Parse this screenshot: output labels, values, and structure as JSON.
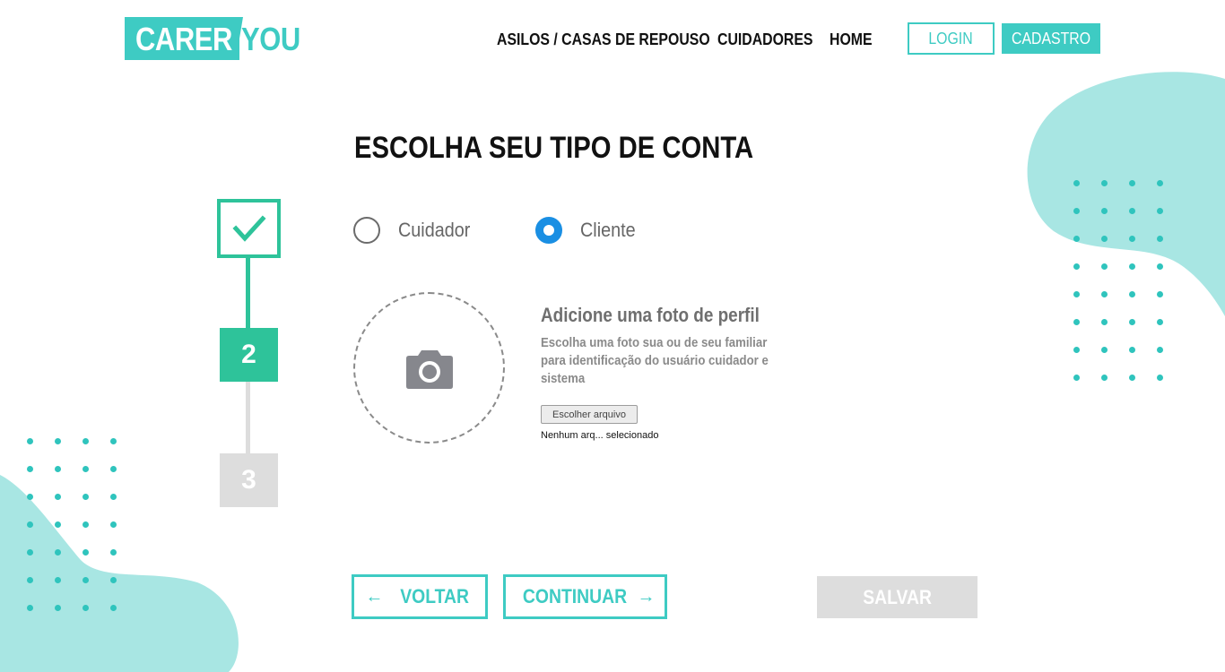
{
  "brand": {
    "part1": "CARER",
    "part2": "YOU",
    "accent_color": "#3ecbc3",
    "step_color": "#2ec39a"
  },
  "nav": {
    "items": [
      "ASILOS / CASAS DE REPOUSO",
      "CUIDADORES",
      "HOME"
    ],
    "login_label": "LOGIN",
    "signup_label": "CADASTRO"
  },
  "page": {
    "title": "ESCOLHA SEU TIPO DE CONTA"
  },
  "stepper": {
    "steps": [
      {
        "label": "",
        "state": "completed",
        "icon": "check-icon"
      },
      {
        "label": "2",
        "state": "active"
      },
      {
        "label": "3",
        "state": "pending"
      }
    ]
  },
  "account_type": {
    "options": [
      {
        "label": "Cuidador",
        "selected": false
      },
      {
        "label": "Cliente",
        "selected": true
      }
    ],
    "selected_color": "#1a8fe3"
  },
  "photo": {
    "icon": "camera-icon",
    "heading": "Adicione uma foto de perfil",
    "description": "Escolha uma foto sua ou de seu familiar para identificação do usuário cuidador e sistema",
    "choose_button": "Escolher arquivo",
    "file_status": "Nenhum arq... selecionado"
  },
  "actions": {
    "back_label": "VOLTAR",
    "continue_label": "CONTINUAR",
    "save_label": "SALVAR",
    "back_icon": "arrow-left-icon",
    "continue_icon": "arrow-right-icon"
  }
}
